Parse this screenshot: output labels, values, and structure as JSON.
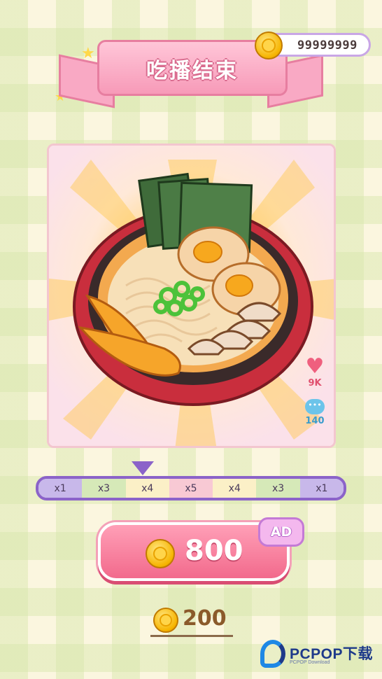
{
  "header": {
    "title": "吃播结束",
    "coins": "99999999"
  },
  "dish": {
    "name_icon": "ramen-bowl",
    "likes": "9K",
    "comments": "140"
  },
  "multiplier_bar": {
    "segments": [
      "x1",
      "x3",
      "x4",
      "x5",
      "x4",
      "x3",
      "x1"
    ],
    "segment_colors": [
      "#c8b8ea",
      "#d6e9b8",
      "#fbf0c7",
      "#f8c9d4",
      "#fbf0c7",
      "#d6e9b8",
      "#c8b8ea"
    ],
    "pointer_index": 2
  },
  "reward": {
    "ad_amount": "800",
    "ad_label": "AD",
    "plain_amount": "200"
  },
  "watermark": {
    "brand": "PCPOP下载",
    "sub": "PCPOP Download"
  },
  "colors": {
    "accent_pink": "#f26a8c",
    "accent_purple": "#8b63c9",
    "coin_gold": "#f6b400"
  }
}
